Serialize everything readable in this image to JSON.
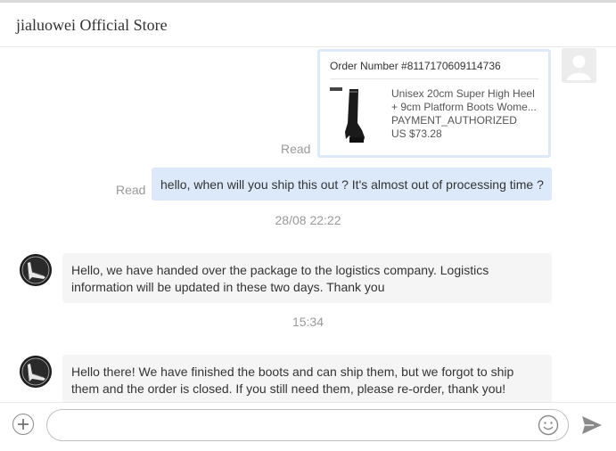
{
  "header": {
    "title": "jialuowei Official Store"
  },
  "order": {
    "number_label": "Order Number #8117170609114736",
    "product_name_line1": "Unisex 20cm Super High Heel",
    "product_name_line2": "+ 9cm Platform Boots Wome...",
    "status": "PAYMENT_AUTHORIZED",
    "price": "US $73.28",
    "read_label": "Read"
  },
  "messages": {
    "outgoing": {
      "text": "hello, when will you ship this out ? It's almost out of processing time ?",
      "read_label": "Read"
    },
    "timestamp1": "28/08 22:22",
    "incoming1": {
      "line1": "Hello, we have handed over the package to the logistics company. Logistics",
      "line2": "information will be updated in these two days. Thank you"
    },
    "timestamp2": "15:34",
    "incoming2": {
      "line1": "Hello there! We have finished the boots and can ship them, but we forgot to ship",
      "line2": "them and the order is closed. If you still need them, please re-order, thank you!"
    }
  },
  "composer": {
    "placeholder": ""
  },
  "icons": {
    "plus": "plus-icon",
    "emoji": "emoji-icon",
    "send": "send-icon",
    "user_avatar": "user-avatar-icon",
    "store_avatar": "store-avatar-icon"
  },
  "colors": {
    "outgoing_bubble": "#dce9fb",
    "incoming_bubble": "#f5f5f5",
    "muted_text": "#999999"
  }
}
